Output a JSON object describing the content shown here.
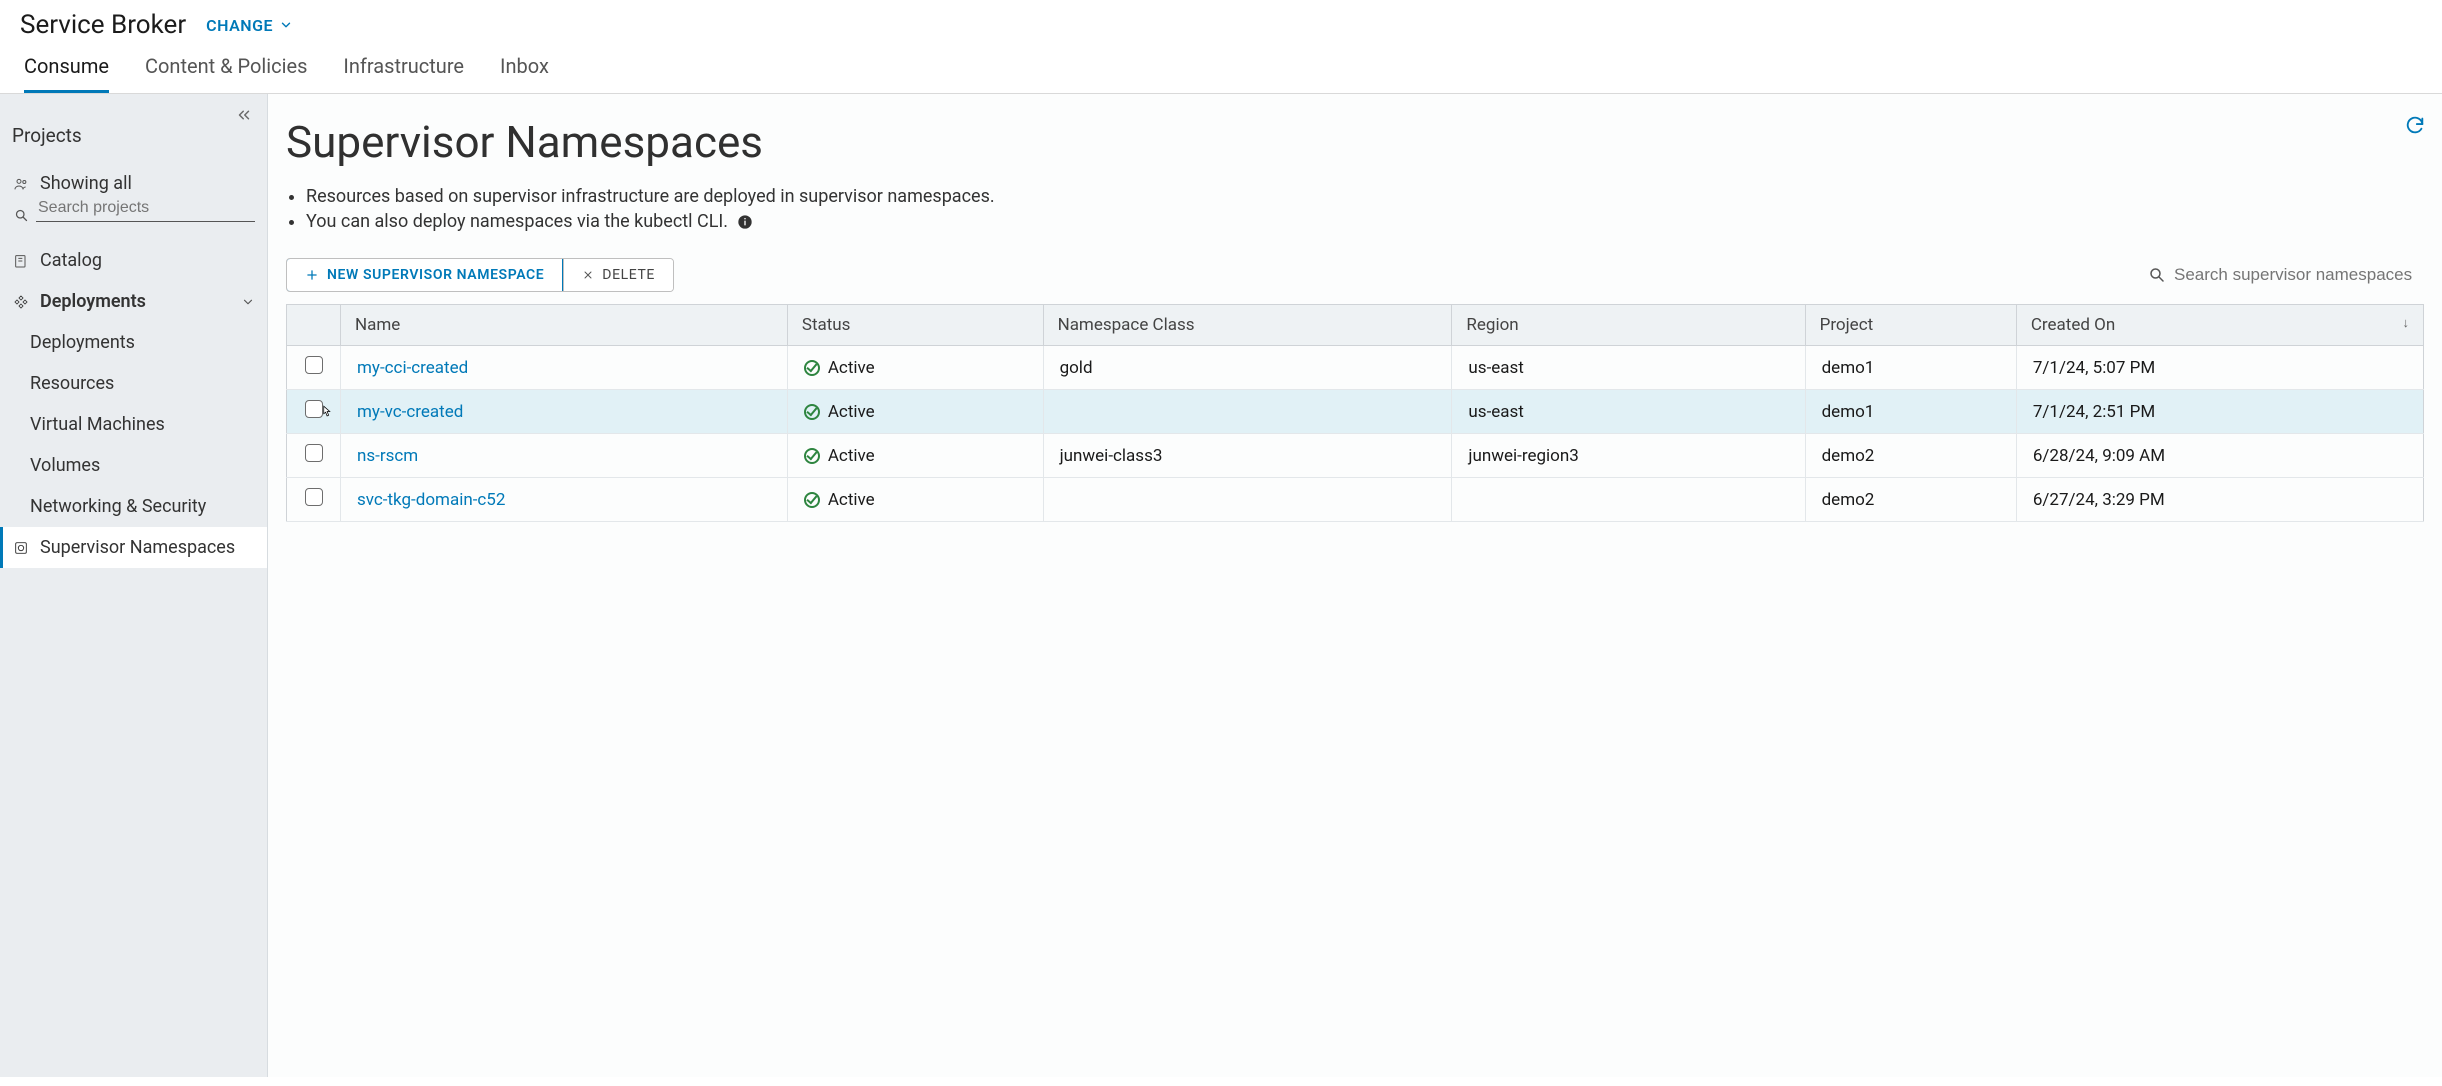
{
  "header": {
    "app_title": "Service Broker",
    "change_label": "CHANGE"
  },
  "tabs": [
    {
      "label": "Consume",
      "active": true
    },
    {
      "label": "Content & Policies",
      "active": false
    },
    {
      "label": "Infrastructure",
      "active": false
    },
    {
      "label": "Inbox",
      "active": false
    }
  ],
  "sidebar": {
    "projects_title": "Projects",
    "showing_all": "Showing all",
    "search_placeholder": "Search projects",
    "catalog": "Catalog",
    "deployments_group": "Deployments",
    "deployments": "Deployments",
    "resources": "Resources",
    "virtual_machines": "Virtual Machines",
    "volumes": "Volumes",
    "networking": "Networking & Security",
    "supervisor_namespaces": "Supervisor Namespaces"
  },
  "page": {
    "title": "Supervisor Namespaces",
    "desc1": "Resources based on supervisor infrastructure are deployed in supervisor namespaces.",
    "desc2": "You can also deploy namespaces via the kubectl CLI."
  },
  "toolbar": {
    "new_label": "NEW SUPERVISOR NAMESPACE",
    "delete_label": "DELETE",
    "search_placeholder": "Search supervisor namespaces"
  },
  "table": {
    "columns": {
      "name": "Name",
      "status": "Status",
      "namespace_class": "Namespace Class",
      "region": "Region",
      "project": "Project",
      "created_on": "Created On"
    },
    "rows": [
      {
        "name": "my-cci-created",
        "status": "Active",
        "namespace_class": "gold",
        "region": "us-east",
        "project": "demo1",
        "created_on": "7/1/24, 5:07 PM"
      },
      {
        "name": "my-vc-created",
        "status": "Active",
        "namespace_class": "",
        "region": "us-east",
        "project": "demo1",
        "created_on": "7/1/24, 2:51 PM"
      },
      {
        "name": "ns-rscm",
        "status": "Active",
        "namespace_class": "junwei-class3",
        "region": "junwei-region3",
        "project": "demo2",
        "created_on": "6/28/24, 9:09 AM"
      },
      {
        "name": "svc-tkg-domain-c52",
        "status": "Active",
        "namespace_class": "",
        "region": "",
        "project": "demo2",
        "created_on": "6/27/24, 3:29 PM"
      }
    ]
  }
}
